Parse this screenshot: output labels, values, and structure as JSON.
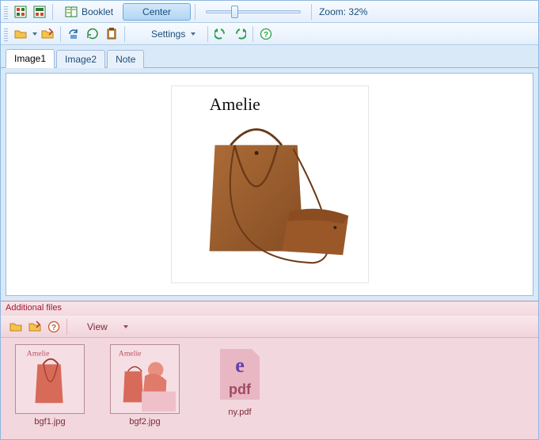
{
  "toolbar1": {
    "booklet_label": "Booklet",
    "center_label": "Center",
    "zoom_text": "Zoom: 32%",
    "zoom_percent": 32
  },
  "toolbar2": {
    "settings_label": "Settings"
  },
  "tabs": [
    {
      "label": "Image1",
      "active": true
    },
    {
      "label": "Image2",
      "active": false
    },
    {
      "label": "Note",
      "active": false
    }
  ],
  "preview": {
    "brand_text": "Amelie"
  },
  "additional": {
    "header": "Additional files",
    "view_label": "View",
    "files": [
      {
        "name": "bgf1.jpg",
        "type": "image"
      },
      {
        "name": "bgf2.jpg",
        "type": "image"
      },
      {
        "name": "ny.pdf",
        "type": "pdf"
      }
    ],
    "pdf_ext_label": "pdf"
  }
}
